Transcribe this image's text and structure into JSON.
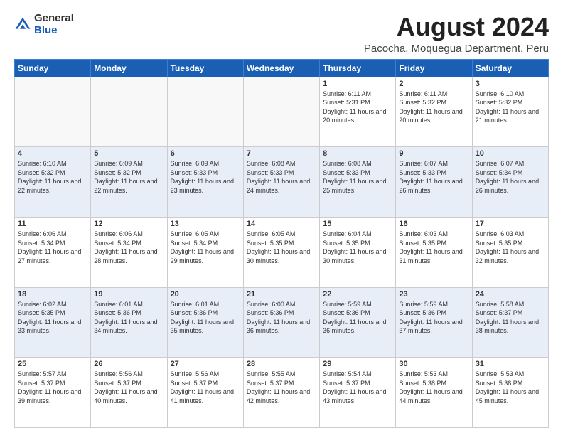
{
  "header": {
    "logo_general": "General",
    "logo_blue": "Blue",
    "month_year": "August 2024",
    "location": "Pacocha, Moquegua Department, Peru"
  },
  "days_of_week": [
    "Sunday",
    "Monday",
    "Tuesday",
    "Wednesday",
    "Thursday",
    "Friday",
    "Saturday"
  ],
  "weeks": [
    [
      {
        "day": "",
        "empty": true
      },
      {
        "day": "",
        "empty": true
      },
      {
        "day": "",
        "empty": true
      },
      {
        "day": "",
        "empty": true
      },
      {
        "day": "1",
        "sunrise": "6:11 AM",
        "sunset": "5:31 PM",
        "daylight": "11 hours and 20 minutes."
      },
      {
        "day": "2",
        "sunrise": "6:11 AM",
        "sunset": "5:32 PM",
        "daylight": "11 hours and 20 minutes."
      },
      {
        "day": "3",
        "sunrise": "6:10 AM",
        "sunset": "5:32 PM",
        "daylight": "11 hours and 21 minutes."
      }
    ],
    [
      {
        "day": "4",
        "sunrise": "6:10 AM",
        "sunset": "5:32 PM",
        "daylight": "11 hours and 22 minutes."
      },
      {
        "day": "5",
        "sunrise": "6:09 AM",
        "sunset": "5:32 PM",
        "daylight": "11 hours and 22 minutes."
      },
      {
        "day": "6",
        "sunrise": "6:09 AM",
        "sunset": "5:33 PM",
        "daylight": "11 hours and 23 minutes."
      },
      {
        "day": "7",
        "sunrise": "6:08 AM",
        "sunset": "5:33 PM",
        "daylight": "11 hours and 24 minutes."
      },
      {
        "day": "8",
        "sunrise": "6:08 AM",
        "sunset": "5:33 PM",
        "daylight": "11 hours and 25 minutes."
      },
      {
        "day": "9",
        "sunrise": "6:07 AM",
        "sunset": "5:33 PM",
        "daylight": "11 hours and 26 minutes."
      },
      {
        "day": "10",
        "sunrise": "6:07 AM",
        "sunset": "5:34 PM",
        "daylight": "11 hours and 26 minutes."
      }
    ],
    [
      {
        "day": "11",
        "sunrise": "6:06 AM",
        "sunset": "5:34 PM",
        "daylight": "11 hours and 27 minutes."
      },
      {
        "day": "12",
        "sunrise": "6:06 AM",
        "sunset": "5:34 PM",
        "daylight": "11 hours and 28 minutes."
      },
      {
        "day": "13",
        "sunrise": "6:05 AM",
        "sunset": "5:34 PM",
        "daylight": "11 hours and 29 minutes."
      },
      {
        "day": "14",
        "sunrise": "6:05 AM",
        "sunset": "5:35 PM",
        "daylight": "11 hours and 30 minutes."
      },
      {
        "day": "15",
        "sunrise": "6:04 AM",
        "sunset": "5:35 PM",
        "daylight": "11 hours and 30 minutes."
      },
      {
        "day": "16",
        "sunrise": "6:03 AM",
        "sunset": "5:35 PM",
        "daylight": "11 hours and 31 minutes."
      },
      {
        "day": "17",
        "sunrise": "6:03 AM",
        "sunset": "5:35 PM",
        "daylight": "11 hours and 32 minutes."
      }
    ],
    [
      {
        "day": "18",
        "sunrise": "6:02 AM",
        "sunset": "5:35 PM",
        "daylight": "11 hours and 33 minutes."
      },
      {
        "day": "19",
        "sunrise": "6:01 AM",
        "sunset": "5:36 PM",
        "daylight": "11 hours and 34 minutes."
      },
      {
        "day": "20",
        "sunrise": "6:01 AM",
        "sunset": "5:36 PM",
        "daylight": "11 hours and 35 minutes."
      },
      {
        "day": "21",
        "sunrise": "6:00 AM",
        "sunset": "5:36 PM",
        "daylight": "11 hours and 36 minutes."
      },
      {
        "day": "22",
        "sunrise": "5:59 AM",
        "sunset": "5:36 PM",
        "daylight": "11 hours and 36 minutes."
      },
      {
        "day": "23",
        "sunrise": "5:59 AM",
        "sunset": "5:36 PM",
        "daylight": "11 hours and 37 minutes."
      },
      {
        "day": "24",
        "sunrise": "5:58 AM",
        "sunset": "5:37 PM",
        "daylight": "11 hours and 38 minutes."
      }
    ],
    [
      {
        "day": "25",
        "sunrise": "5:57 AM",
        "sunset": "5:37 PM",
        "daylight": "11 hours and 39 minutes."
      },
      {
        "day": "26",
        "sunrise": "5:56 AM",
        "sunset": "5:37 PM",
        "daylight": "11 hours and 40 minutes."
      },
      {
        "day": "27",
        "sunrise": "5:56 AM",
        "sunset": "5:37 PM",
        "daylight": "11 hours and 41 minutes."
      },
      {
        "day": "28",
        "sunrise": "5:55 AM",
        "sunset": "5:37 PM",
        "daylight": "11 hours and 42 minutes."
      },
      {
        "day": "29",
        "sunrise": "5:54 AM",
        "sunset": "5:37 PM",
        "daylight": "11 hours and 43 minutes."
      },
      {
        "day": "30",
        "sunrise": "5:53 AM",
        "sunset": "5:38 PM",
        "daylight": "11 hours and 44 minutes."
      },
      {
        "day": "31",
        "sunrise": "5:53 AM",
        "sunset": "5:38 PM",
        "daylight": "11 hours and 45 minutes."
      }
    ]
  ]
}
